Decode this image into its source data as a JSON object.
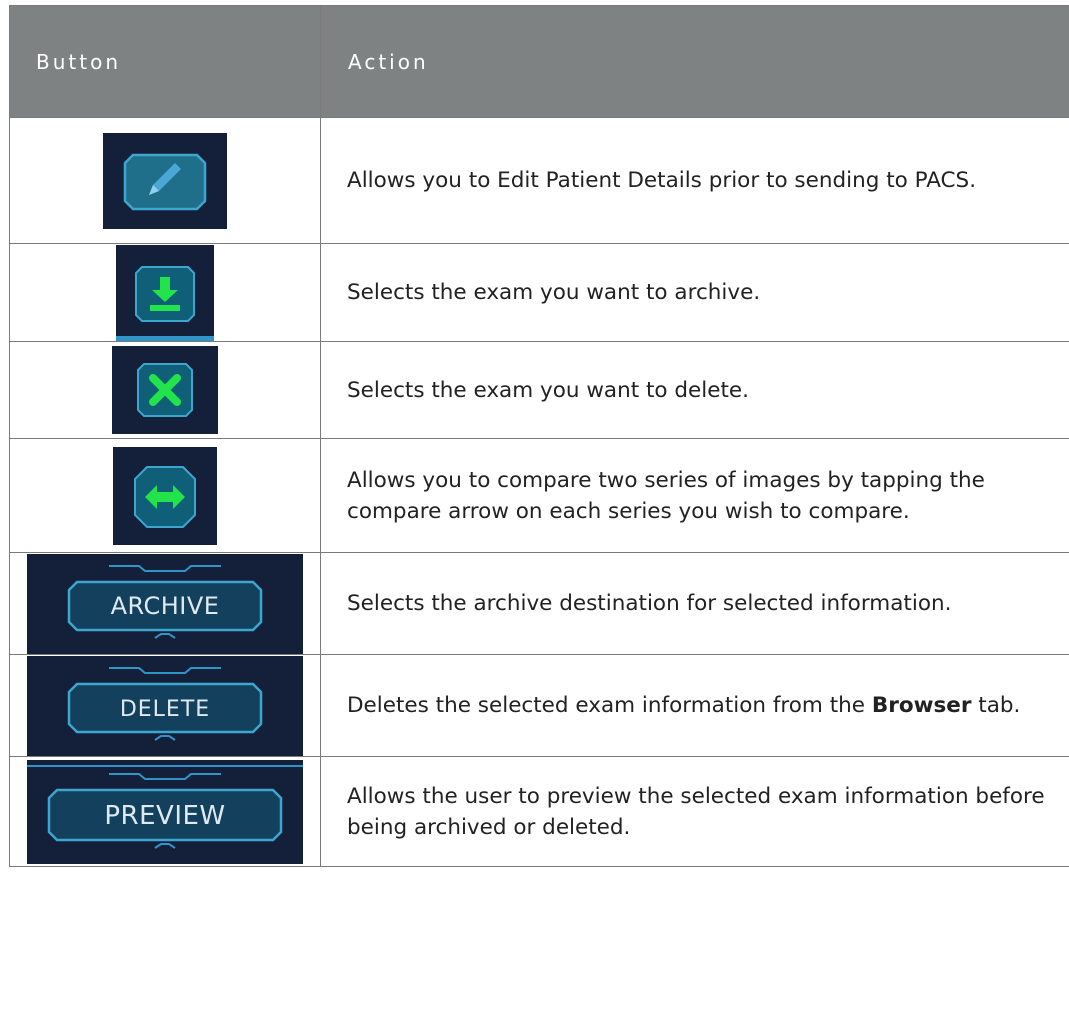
{
  "table": {
    "header": {
      "col_button": "Button",
      "col_action": "Action"
    },
    "rows": [
      {
        "button_icon": "edit-pencil-icon",
        "action": "Allows you to Edit Patient Details prior to sending to PACS."
      },
      {
        "button_icon": "archive-download-icon",
        "action": "Selects the exam you want to archive."
      },
      {
        "button_icon": "delete-x-icon",
        "action": "Selects the exam you want to delete."
      },
      {
        "button_icon": "compare-arrows-icon",
        "action": "Allows you to compare two series of images by tapping the compare arrow on each series you wish to compare."
      },
      {
        "button_label": "ARCHIVE",
        "action": "Selects the archive destination for selected information."
      },
      {
        "button_label": "DELETE",
        "action_pre": "Deletes the selected exam information from the ",
        "action_bold": "Browser",
        "action_post": " tab."
      },
      {
        "button_label": "PREVIEW",
        "action": "Allows the user to preview the selected exam information before being archived or deleted."
      }
    ]
  },
  "colors": {
    "header_bg": "#7f8283",
    "button_dark_bg": "#14203a",
    "button_icon_bg": "#0f5f78",
    "icon_green": "#22e34a",
    "button_outline": "#2f95c8"
  }
}
